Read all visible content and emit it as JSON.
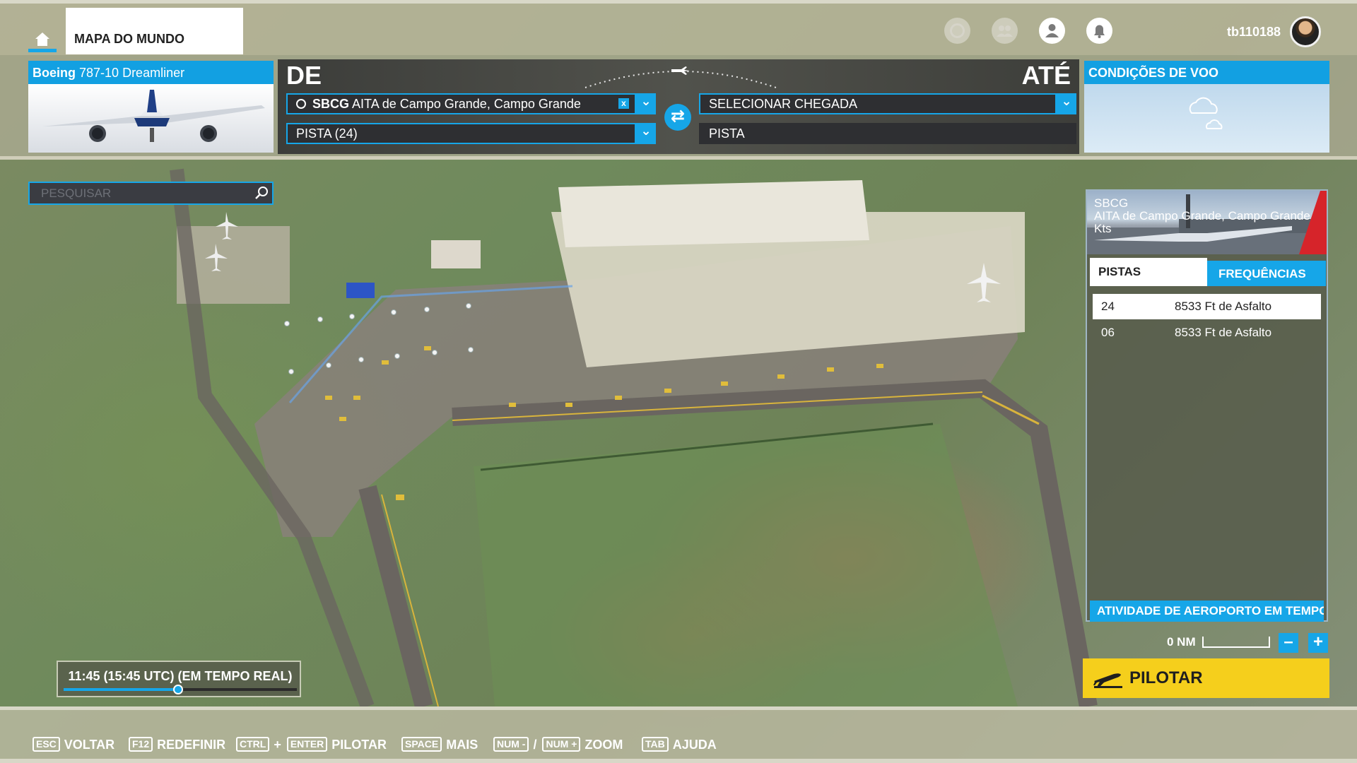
{
  "header": {
    "tab_label": "MAPA DO MUNDO",
    "username": "tb110188",
    "icons": [
      "home-icon",
      "activity-icon",
      "friends-icon",
      "profile-icon",
      "notifications-icon"
    ]
  },
  "aircraft": {
    "make": "Boeing",
    "model": "787-10 Dreamliner"
  },
  "route": {
    "from_label": "DE",
    "to_label": "ATÉ",
    "departure_code": "SBCG",
    "departure_name": "AITA de Campo Grande, Campo Grande",
    "departure_runway": "PISTA (24)",
    "arrival_placeholder": "SELECIONAR CHEGADA",
    "arrival_runway": "PISTA"
  },
  "conditions": {
    "title": "CONDIÇÕES DE VOO"
  },
  "search": {
    "placeholder": "PESQUISAR"
  },
  "airport_panel": {
    "code": "SBCG",
    "name": "AITA de Campo Grande, Campo Grande",
    "wind": "Kts",
    "tabs": [
      "PISTAS",
      "FREQUÊNCIAS"
    ],
    "runways": [
      {
        "id": "24",
        "info": "8533 Ft de Asfalto"
      },
      {
        "id": "06",
        "info": "8533 Ft de Asfalto"
      }
    ],
    "activity_button": "ATIVIDADE DE AEROPORTO EM TEMPO REAL"
  },
  "map_scale": {
    "label": "0 NM",
    "zoom_out": "–",
    "zoom_in": "+"
  },
  "fly_button": "PILOTAR",
  "time": {
    "label": "11:45 (15:45 UTC) (EM TEMPO REAL)",
    "slider_fraction": 0.49
  },
  "hotkeys": [
    {
      "keys": [
        "ESC"
      ],
      "action": "VOLTAR"
    },
    {
      "keys": [
        "F12"
      ],
      "action": "REDEFINIR"
    },
    {
      "keys": [
        "CTRL",
        "ENTER"
      ],
      "sep": "+",
      "action": "PILOTAR"
    },
    {
      "keys": [
        "SPACE"
      ],
      "action": "MAIS"
    },
    {
      "keys": [
        "NUM -",
        "NUM +"
      ],
      "sep": "/",
      "action": "ZOOM"
    },
    {
      "keys": [
        "TAB"
      ],
      "action": "AJUDA"
    }
  ],
  "colors": {
    "accent": "#16a6e8",
    "fly_button": "#f5cf1c"
  }
}
